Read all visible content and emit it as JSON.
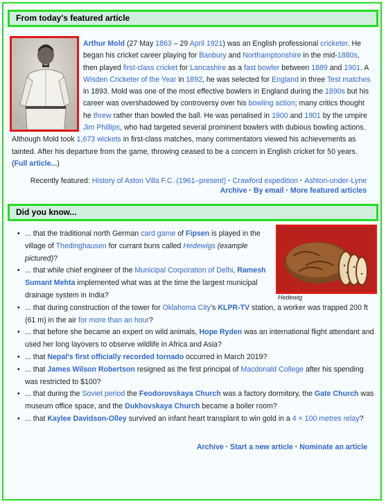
{
  "tfa": {
    "header": "From today's featured article",
    "t": [
      "Arthur Mold",
      " (27 May ",
      "1863",
      " – 29 ",
      "April",
      " ",
      "1921",
      ") was an English professional ",
      "cricketer",
      ". He began his cricket career playing for ",
      "Banbury",
      " and ",
      "Northamptonshire",
      " in the mid-",
      "1880s",
      ", then played ",
      "first-class cricket",
      " for ",
      "Lancashire",
      " as a ",
      "fast bowler",
      " between ",
      "1889",
      " and ",
      "1901",
      ". A ",
      "Wisden Cricketer of the Year",
      " in ",
      "1892",
      ", he was selected for ",
      "England",
      " in three ",
      "Test matches",
      " in 1893. Mold was one of the most effective bowlers in England during the ",
      "1890s",
      " but his career was overshadowed by controversy over his ",
      "bowling action",
      "; many critics thought he ",
      "threw",
      " rather than bowled the ball. He was penalised in ",
      "1900",
      " and ",
      "1901",
      " by the umpire ",
      "Jim Phillips",
      ", who had targeted several prominent bowlers with dubious bowling actions. Although Mold took ",
      "1,673",
      " ",
      "wickets",
      " in first-class matches, many commentators viewed his achievements as tainted. After his departure from the game, throwing ceased to be a concern in English cricket for 50 years. (",
      "Full article...",
      ")"
    ],
    "recent": {
      "label": "Recently featured: ",
      "items": [
        "History of Aston Villa F.C. (1961–present)",
        "Crawford expedition",
        "Ashton-under-Lyne"
      ]
    },
    "links": {
      "archive": "Archive",
      "by_email": "By email",
      "more": "More featured articles"
    }
  },
  "dyk": {
    "header": "Did you know...",
    "caption": "Hedewig",
    "items": [
      [
        "... that the traditional north German ",
        "card game",
        " of ",
        "Fipsen",
        " is played in the village of ",
        "Thedinghausen",
        " for currant buns called ",
        "Hedewigs",
        " ",
        "(example pictured)",
        "?"
      ],
      [
        "... that while chief engineer of the ",
        "Municipal Corporation of Delhi",
        ", ",
        "Ramesh Sumant Mehta",
        " implemented what was at the time the largest municipal drainage system in India?"
      ],
      [
        "... that during construction of the tower for ",
        "Oklahoma City",
        "'s ",
        "KLPR-TV",
        " station, a worker was trapped 200 ft (61 m) in the air ",
        "for more than an hour",
        "?"
      ],
      [
        "... that before she became an expert on wild animals, ",
        "Hope Ryden",
        " was an international flight attendant and used her long layovers to observe wildlife in Africa and Asia?"
      ],
      [
        "... that ",
        "Nepal's first officially recorded tornado",
        " occurred in March 2019?"
      ],
      [
        "... that ",
        "James Wilson Robertson",
        " resigned as the first principal of ",
        "Macdonald College",
        " after his spending was restricted to $100?"
      ],
      [
        "... that during the ",
        "Soviet period",
        " the ",
        "Feodorovskaya Church",
        " was a factory dormitory, the ",
        "Gate Church",
        " was museum office space, and the ",
        "Dukhovskaya Church",
        " became a boiler room?"
      ],
      [
        "... that ",
        "Kaylee Davidson-Olley",
        " survived an infant heart transplant to win gold in a ",
        "4 × 100 metres relay",
        "?"
      ]
    ],
    "links": {
      "archive": "Archive",
      "start_new": "Start a new article",
      "nominate": "Nominate an article"
    }
  }
}
